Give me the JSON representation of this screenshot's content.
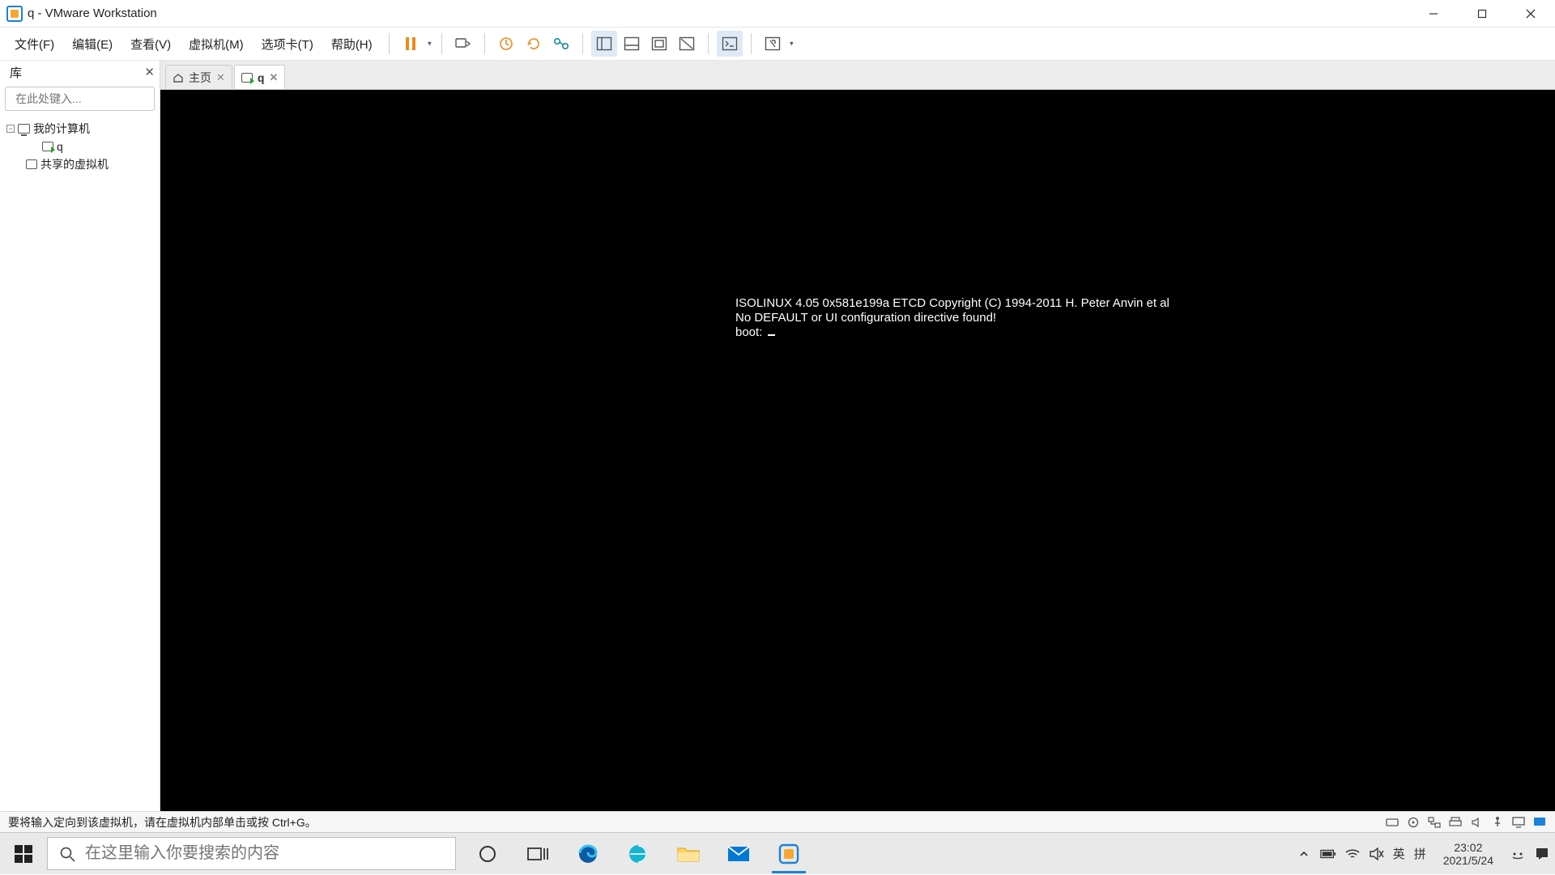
{
  "window": {
    "title": "q - VMware Workstation"
  },
  "menubar": {
    "file": "文件(F)",
    "edit": "编辑(E)",
    "view": "查看(V)",
    "vm": "虚拟机(M)",
    "tabs": "选项卡(T)",
    "help": "帮助(H)"
  },
  "sidebar": {
    "title": "库",
    "search_placeholder": "在此处键入...",
    "tree": {
      "my_computer": "我的计算机",
      "vm_q": "q",
      "shared": "共享的虚拟机"
    }
  },
  "tabs": {
    "home": "主页",
    "vm": "q"
  },
  "console": {
    "line1": "ISOLINUX 4.05 0x581e199a ETCD Copyright (C) 1994-2011 H. Peter Anvin et al",
    "line2": "No DEFAULT or UI configuration directive found!",
    "line3": "boot: "
  },
  "statusbar": {
    "hint": "要将输入定向到该虚拟机，请在虚拟机内部单击或按 Ctrl+G。"
  },
  "taskbar": {
    "search_placeholder": "在这里输入你要搜索的内容",
    "ime_lang": "英",
    "ime_mode": "拼",
    "clock_time": "23:02",
    "clock_date": "2021/5/24"
  }
}
